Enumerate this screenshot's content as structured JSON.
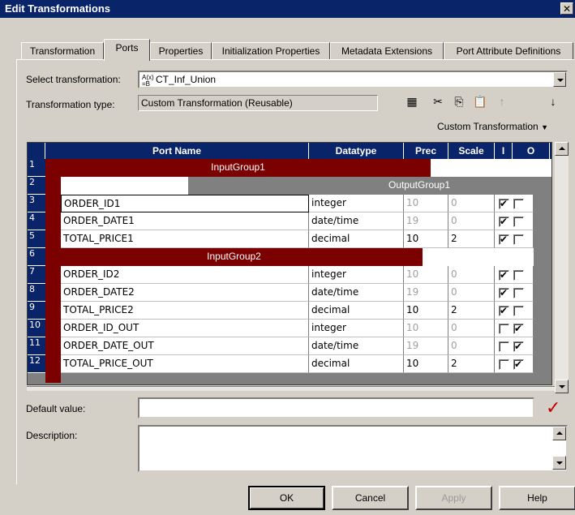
{
  "window": {
    "title": "Edit Transformations",
    "close": "✕"
  },
  "tabs": [
    "Transformation",
    "Ports",
    "Properties",
    "Initialization Properties",
    "Metadata Extensions",
    "Port Attribute Definitions"
  ],
  "select_transformation": {
    "label": "Select transformation:",
    "value": "CT_Inf_Union",
    "icon": "custom-transformation-icon"
  },
  "transformation_type": {
    "label": "Transformation type:",
    "value": "Custom Transformation (Reusable)"
  },
  "toolbar": [
    "new-port-icon",
    "cut-icon",
    "copy-icon",
    "paste-icon",
    "move-up-icon",
    "move-down-icon"
  ],
  "custom_transformation_menu": "Custom Transformation",
  "grid": {
    "columns": [
      "Port Name",
      "Datatype",
      "Prec",
      "Scale",
      "I",
      "O"
    ],
    "groups": [
      {
        "row": "1",
        "name": "InputGroup1",
        "kind": "input"
      },
      {
        "row": "2",
        "name": "OutputGroup1",
        "kind": "output"
      },
      {
        "row": "6",
        "name": "InputGroup2",
        "kind": "input"
      }
    ],
    "rows": [
      {
        "num": "3",
        "name": "ORDER_ID1",
        "type": "integer",
        "prec": "10",
        "scale": "0",
        "i": true,
        "o": false,
        "editable": false
      },
      {
        "num": "4",
        "name": "ORDER_DATE1",
        "type": "date/time",
        "prec": "19",
        "scale": "0",
        "i": true,
        "o": false,
        "editable": false
      },
      {
        "num": "5",
        "name": "TOTAL_PRICE1",
        "type": "decimal",
        "prec": "10",
        "scale": "2",
        "i": true,
        "o": false,
        "editable": true
      },
      {
        "num": "7",
        "name": "ORDER_ID2",
        "type": "integer",
        "prec": "10",
        "scale": "0",
        "i": true,
        "o": false,
        "editable": false
      },
      {
        "num": "8",
        "name": "ORDER_DATE2",
        "type": "date/time",
        "prec": "19",
        "scale": "0",
        "i": true,
        "o": false,
        "editable": false
      },
      {
        "num": "9",
        "name": "TOTAL_PRICE2",
        "type": "decimal",
        "prec": "10",
        "scale": "2",
        "i": true,
        "o": false,
        "editable": true
      },
      {
        "num": "10",
        "name": "ORDER_ID_OUT",
        "type": "integer",
        "prec": "10",
        "scale": "0",
        "i": false,
        "o": true,
        "editable": false
      },
      {
        "num": "11",
        "name": "ORDER_DATE_OUT",
        "type": "date/time",
        "prec": "19",
        "scale": "0",
        "i": false,
        "o": true,
        "editable": false
      },
      {
        "num": "12",
        "name": "TOTAL_PRICE_OUT",
        "type": "decimal",
        "prec": "10",
        "scale": "2",
        "i": false,
        "o": true,
        "editable": true
      }
    ]
  },
  "default_value": {
    "label": "Default value:",
    "value": ""
  },
  "description": {
    "label": "Description:",
    "value": ""
  },
  "buttons": {
    "ok": "OK",
    "cancel": "Cancel",
    "apply": "Apply",
    "help": "Help"
  },
  "colors": {
    "title_bar": "#0a246a",
    "group_bar": "#7b0000",
    "face": "#d4d0c8",
    "check_green": "#c00000"
  }
}
